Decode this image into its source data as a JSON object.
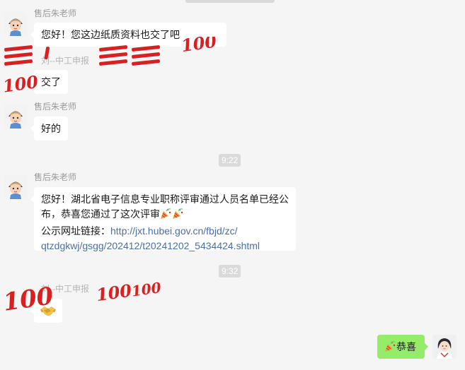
{
  "conversation": {
    "messages": [
      {
        "sender": "售后朱老师",
        "text": "您好！您这边纸质资料也交了吧"
      },
      {
        "sender": "刘--中工申报",
        "text": "交了"
      },
      {
        "sender": "售后朱老师",
        "text": "好的"
      },
      {
        "time": "9:22"
      },
      {
        "sender": "售后朱老师",
        "lines": [
          "您好！湖北省电子信息专业职称评审通过人员名单已经公",
          "布，恭喜您通过了这次评审",
          "公示网址链接：",
          "http://jxt.hubei.gov.cn/fbjd/zc/",
          "qtzdgkwj/gsgg/202412/t20241202_5434424.shtml"
        ]
      },
      {
        "time": "9:32"
      },
      {
        "sender": "刘--中工申报",
        "emoji": "handshake-icon"
      },
      {
        "self": true,
        "text": "恭喜",
        "emoji": "party-popper-icon"
      }
    ]
  },
  "stickers": {
    "hundred_label": "100"
  },
  "colors": {
    "background": "#f5f5f5",
    "bubble_incoming": "#ffffff",
    "bubble_outgoing": "#95ec69",
    "link": "#4a6fa5",
    "sticker_red": "#d91f1f"
  }
}
